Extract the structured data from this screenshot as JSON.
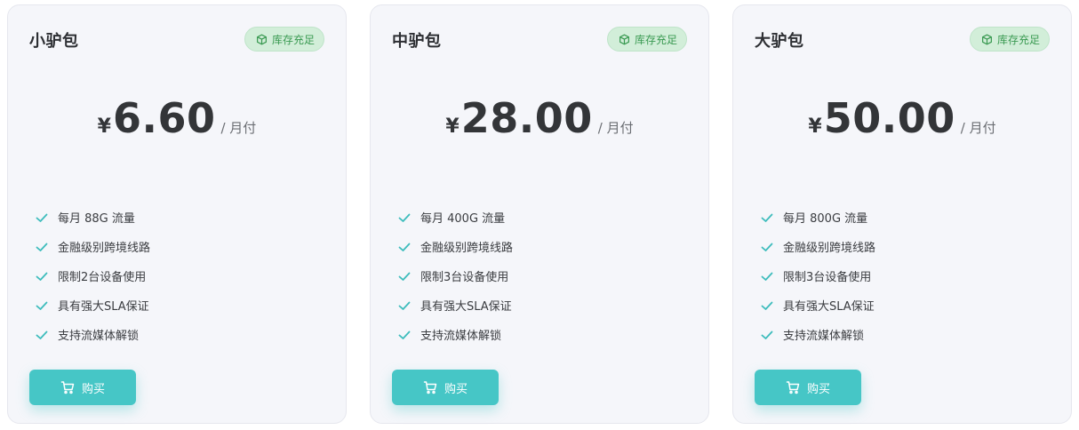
{
  "colors": {
    "accent": "#46c6c6",
    "badge_bg": "#d2eed9",
    "badge_text": "#3a9a52",
    "card_bg": "#f5f6fa"
  },
  "plans": [
    {
      "name": "小驴包",
      "badge": "库存充足",
      "currency": "¥",
      "price": "6.60",
      "period": "/ 月付",
      "features": [
        "每月 88G 流量",
        "金融级别跨境线路",
        "限制2台设备使用",
        "具有强大SLA保证",
        "支持流媒体解锁"
      ],
      "buy_label": "购买"
    },
    {
      "name": "中驴包",
      "badge": "库存充足",
      "currency": "¥",
      "price": "28.00",
      "period": "/ 月付",
      "features": [
        "每月 400G 流量",
        "金融级别跨境线路",
        "限制3台设备使用",
        "具有强大SLA保证",
        "支持流媒体解锁"
      ],
      "buy_label": "购买"
    },
    {
      "name": "大驴包",
      "badge": "库存充足",
      "currency": "¥",
      "price": "50.00",
      "period": "/ 月付",
      "features": [
        "每月 800G 流量",
        "金融级别跨境线路",
        "限制3台设备使用",
        "具有强大SLA保证",
        "支持流媒体解锁"
      ],
      "buy_label": "购买"
    }
  ],
  "icons": {
    "badge": "cube-icon",
    "feature": "check-icon",
    "buy": "cart-icon"
  }
}
